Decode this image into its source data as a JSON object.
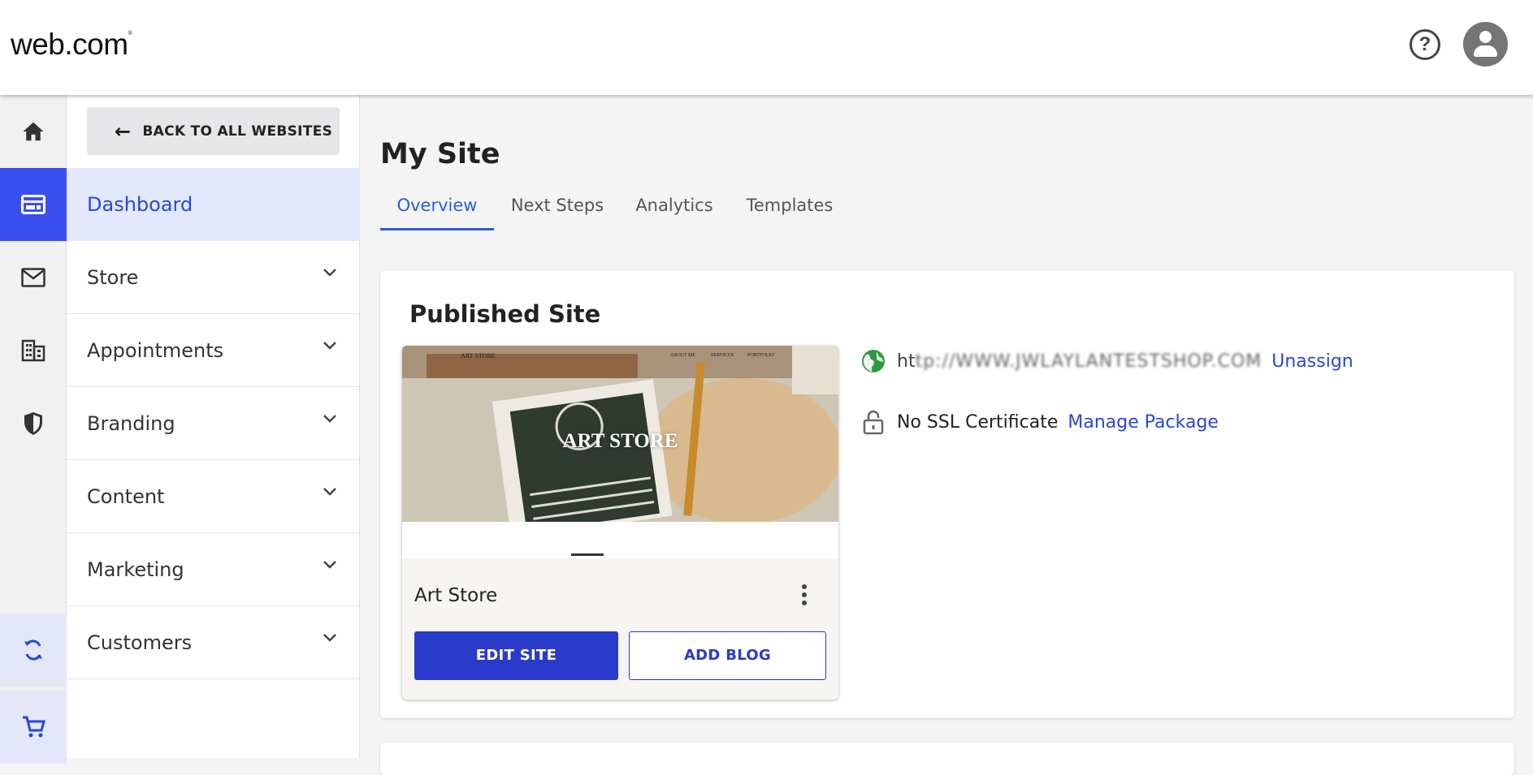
{
  "header": {
    "logo_text": "web.com",
    "logo_mark": "®"
  },
  "sidebar": {
    "back_label": "BACK TO ALL WEBSITES",
    "items": [
      {
        "label": "Dashboard",
        "active": true
      },
      {
        "label": "Store"
      },
      {
        "label": "Appointments"
      },
      {
        "label": "Branding"
      },
      {
        "label": "Content"
      },
      {
        "label": "Marketing"
      },
      {
        "label": "Customers"
      }
    ]
  },
  "rail": {
    "icons": [
      "home-icon",
      "dashboard-icon",
      "mail-icon",
      "building-icon",
      "security-icon",
      "sync-icon",
      "cart-icon"
    ],
    "accent_color": "#3a4ff0"
  },
  "main": {
    "title": "My Site",
    "tabs": [
      {
        "label": "Overview",
        "active": true
      },
      {
        "label": "Next Steps"
      },
      {
        "label": "Analytics"
      },
      {
        "label": "Templates"
      }
    ]
  },
  "published": {
    "title": "Published Site",
    "thumbnail": {
      "heading": "ART STORE",
      "nav_brand": "ART STORE",
      "nav_links": [
        "ABOUT ME",
        "SERVICES",
        "PORTFOLIO"
      ]
    },
    "site_name": "Art Store",
    "edit_label": "EDIT SITE",
    "blog_label": "ADD BLOG",
    "domain_prefix": "ht",
    "domain_blurred": "tp://WWW.JWLAYLANTESTSHOP.COM",
    "unassign_label": "Unassign",
    "ssl_text": "No SSL Certificate",
    "manage_label": "Manage Package",
    "primary_color": "#2a3bcc"
  }
}
